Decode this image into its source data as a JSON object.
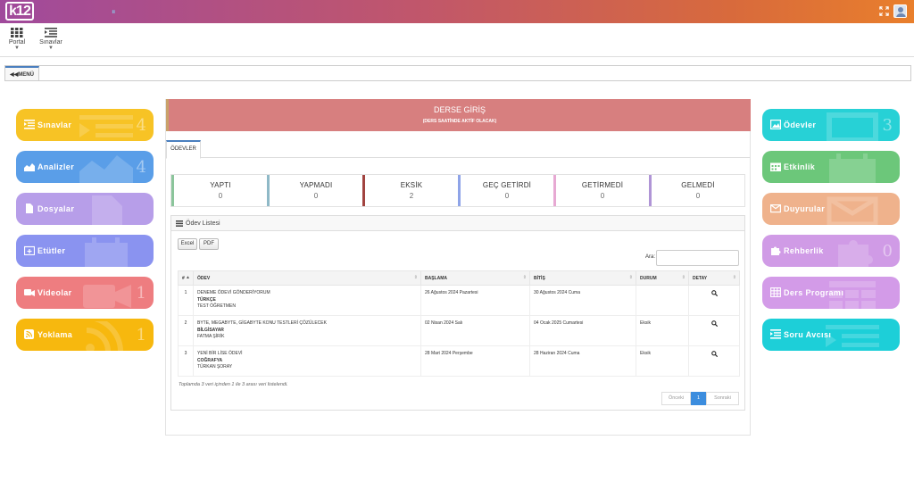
{
  "header": {
    "logo_text": "k12",
    "expand_icon": "expand-icon",
    "avatar_icon": "user-avatar"
  },
  "toolbar": {
    "items": [
      {
        "label": "Portal",
        "icon": "grid-icon"
      },
      {
        "label": "Sınavlar",
        "icon": "list-indent-icon"
      }
    ]
  },
  "breadcrumb": {
    "menu_label": "MENÜ"
  },
  "left_tiles": [
    {
      "label": "Sınavlar",
      "count": "4",
      "color": "#f7c325",
      "icon": "list-icon"
    },
    {
      "label": "Analizler",
      "count": "4",
      "color": "#5a9ee8",
      "icon": "area-chart-icon"
    },
    {
      "label": "Dosyalar",
      "count": "",
      "color": "#b79ee9",
      "icon": "file-icon"
    },
    {
      "label": "Etütler",
      "count": "",
      "color": "#8a93f0",
      "icon": "calendar-plus-icon"
    },
    {
      "label": "Videolar",
      "count": "1",
      "color": "#ee7d80",
      "icon": "video-icon"
    },
    {
      "label": "Yoklama",
      "count": "1",
      "color": "#f7b80e",
      "icon": "rss-icon"
    }
  ],
  "right_tiles": [
    {
      "label": "Ödevler",
      "count": "3",
      "color": "#27d1d6",
      "icon": "picture-icon"
    },
    {
      "label": "Etkinlik",
      "count": "",
      "color": "#6cc77a",
      "icon": "calendar-icon"
    },
    {
      "label": "Duyurular",
      "count": "",
      "color": "#efb28c",
      "icon": "envelope-icon"
    },
    {
      "label": "Rehberlik",
      "count": "0",
      "color": "#d09be6",
      "icon": "puzzle-icon"
    },
    {
      "label": "Ders Programı",
      "count": "",
      "color": "#d39be8",
      "icon": "table-icon"
    },
    {
      "label": "Soru Avcısı",
      "count": "",
      "color": "#1dcfd8",
      "icon": "list-icon"
    }
  ],
  "ders_giris": {
    "title": "DERSE GİRİŞ",
    "subtitle": "(DERS SAATİNDE AKTİF OLACAK)",
    "color": "#d77f7f"
  },
  "tab": {
    "label": "ÖDEVLER"
  },
  "stats": [
    {
      "label": "YAPTI",
      "value": "0",
      "color": "#8bc59b"
    },
    {
      "label": "YAPMADI",
      "value": "0",
      "color": "#8fb9c7"
    },
    {
      "label": "EKSİK",
      "value": "2",
      "color": "#a1433f"
    },
    {
      "label": "GEÇ GETİRDİ",
      "value": "0",
      "color": "#8fa4e8"
    },
    {
      "label": "GETİRMEDİ",
      "value": "0",
      "color": "#e7a9d3"
    },
    {
      "label": "GELMEDİ",
      "value": "0",
      "color": "#b095d6"
    }
  ],
  "odev_list": {
    "title": "Ödev Listesi",
    "excel_label": "Excel",
    "pdf_label": "PDF",
    "search_label": "Ara:",
    "search_value": "",
    "columns": [
      "#",
      "ÖDEV",
      "BAŞLAMA",
      "BİTİŞ",
      "DURUM",
      "DETAY"
    ],
    "rows": [
      {
        "no": "1",
        "title": "DENEME ÖDEVİ GÖNDERİYORUM",
        "subject": "TÜRKÇE",
        "teacher": "TEST ÖĞRETMEN",
        "start": "26 Ağustos 2024 Pazartesi",
        "end": "30 Ağustos 2024 Cuma",
        "status": ""
      },
      {
        "no": "2",
        "title": "BYTE, MEGABYTE, GİGABYTE KONU TESTLERİ ÇÖZÜLECEK",
        "subject": "BİLGİSAYAR",
        "teacher": "FATMA ŞİRİK",
        "start": "02 Nisan 2024 Salı",
        "end": "04 Ocak 2025 Cumartesi",
        "status": "Eksik"
      },
      {
        "no": "3",
        "title": "YENİ BİR LİSE ÖDEVİ",
        "subject": "COĞRAFYA",
        "teacher": "TÜRKAN ŞORAY",
        "start": "28 Mart 2024 Perşembe",
        "end": "28 Haziran 2024 Cuma",
        "status": "Eksik"
      }
    ],
    "info": "Toplamda 3 veri içinden 1 ile 3 arası veri listelendi.",
    "pager": {
      "prev": "Önceki",
      "current": "1",
      "next": "Sonraki"
    }
  }
}
